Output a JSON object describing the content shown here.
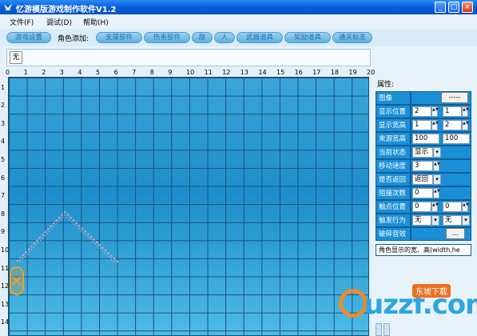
{
  "window": {
    "title": "忆游模版游戏制作软件V1.2",
    "controls": [
      "_",
      "□",
      "×"
    ]
  },
  "menubar": {
    "items": [
      "文件(F)",
      "调试(D)",
      "帮助(H)"
    ]
  },
  "toolbar": {
    "game_settings": "游戏设置",
    "role_add_label": "角色添加:",
    "buttons": [
      "支撑部件",
      "伤害部件",
      "敌",
      "人",
      "武器道具",
      "奖励道具",
      "通关标志"
    ]
  },
  "strip": {
    "none_label": "无"
  },
  "grid": {
    "x_ticks": [
      "0",
      "1",
      "2",
      "3",
      "4",
      "5",
      "6",
      "7",
      "8",
      "9",
      "10",
      "11",
      "12",
      "13",
      "14",
      "15",
      "16",
      "17",
      "18",
      "19",
      "20"
    ],
    "y_ticks": [
      "1",
      "2",
      "3",
      "4",
      "5",
      "6",
      "7",
      "8",
      "9",
      "10",
      "11",
      "12",
      "13",
      "14"
    ]
  },
  "properties": {
    "title": "属性:",
    "image": {
      "label": "图像",
      "button": "-----"
    },
    "display_position": {
      "label": "显示位置",
      "x": "2",
      "y": "1"
    },
    "display_size": {
      "label": "显示宽高",
      "w": "1",
      "h": "2"
    },
    "source_size": {
      "label": "来源宽高",
      "w": "100",
      "h": "100"
    },
    "current_state": {
      "label": "当前状态",
      "value": "显示"
    },
    "move_speed": {
      "label": "移动速度",
      "value": "3"
    },
    "return": {
      "label": "是否返回",
      "value": "返回"
    },
    "collision_count": {
      "label": "阻撞次数",
      "value": "0"
    },
    "trigger_position": {
      "label": "触点位置",
      "x": "0",
      "y": "0"
    },
    "trigger_action": {
      "label": "触发行为",
      "a": "无",
      "b": "无"
    },
    "break_sound": {
      "label": "破碎音效",
      "button": "..."
    },
    "description": "角色显示的宽、高(width,he"
  },
  "watermark": {
    "logo_text": "uzzf.com",
    "badge": "东坡下载"
  },
  "colors": {
    "titlebar": "#0a5ed8",
    "grid_bg": "#1d8ecb",
    "panel_label": "#1b8fd6"
  }
}
